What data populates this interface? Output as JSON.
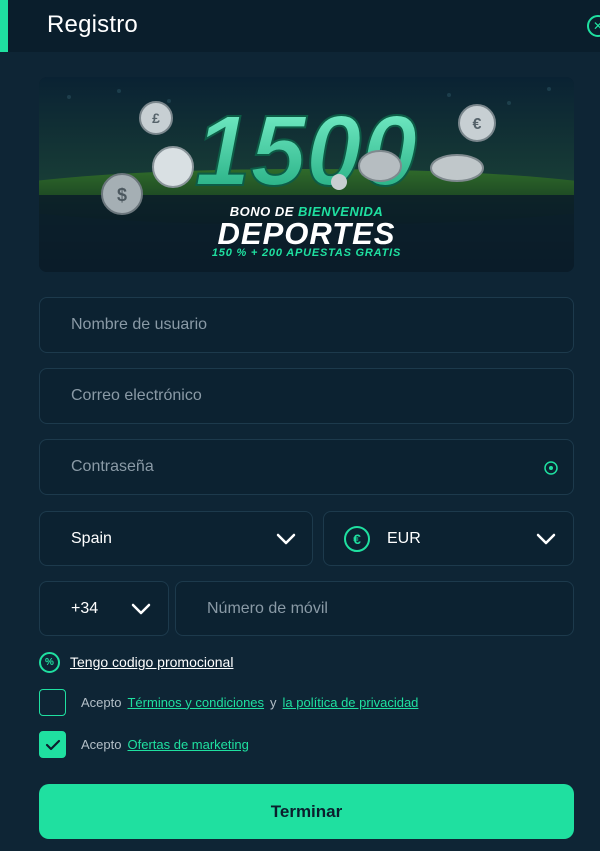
{
  "header": {
    "title": "Registro",
    "close_icon": "close-icon"
  },
  "banner": {
    "amount": "1500",
    "line1_prefix": "BONO DE",
    "line1_highlight": "BIENVENIDA",
    "line2": "DEPORTES",
    "line3": "150 % + 200 APUESTAS GRATIS"
  },
  "form": {
    "username_placeholder": "Nombre de usuario",
    "email_placeholder": "Correo electrónico",
    "password_placeholder": "Contraseña",
    "country_value": "Spain",
    "currency_value": "EUR",
    "phone_prefix": "+34",
    "phone_placeholder": "Número de móvil"
  },
  "promo": {
    "label": "Tengo codigo promocional"
  },
  "terms": {
    "accept": "Acepto",
    "terms_link": "Términos y condiciones",
    "conjunction": "y",
    "privacy_link": "la política de privacidad",
    "checked": false
  },
  "marketing": {
    "accept": "Acepto",
    "link": "Ofertas de marketing",
    "checked": true
  },
  "submit_label": "Terminar",
  "colors": {
    "accent": "#1fe0a0",
    "background": "#0e2535",
    "header_bg": "#0a1e2c",
    "field_border": "#1d3a4c"
  }
}
